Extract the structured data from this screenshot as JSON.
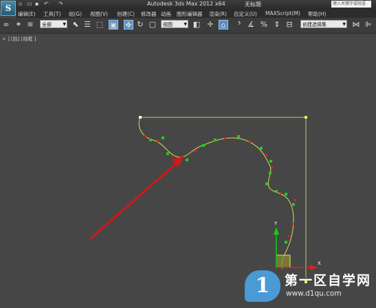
{
  "window": {
    "app_logo": "S",
    "title": "Autodesk 3ds Max  2012 x64",
    "subtitle": "无标题",
    "search_placeholder": "键入关键字或短语"
  },
  "menu": [
    "编辑(E)",
    "工具(T)",
    "组(G)",
    "视图(V)",
    "创建(C)",
    "修改器",
    "动画",
    "图形编辑器",
    "渲染(R)",
    "自定义(U)",
    "MAXScript(M)",
    "帮助(H)"
  ],
  "toolbar": {
    "selection_filter": "全部",
    "coordinate_system": "视图",
    "selection_set": "创建选择集"
  },
  "viewport": {
    "label": "+ ] [前] [线框 ]",
    "axis_y": "Y",
    "axis_x": "X"
  },
  "watermark": {
    "logo": "1",
    "text": "第一区自学网",
    "url": "www.d1qu.com"
  },
  "colors": {
    "spline": "#dcdc50",
    "vertex": "#22cc22",
    "handle": "#e02020",
    "arrow": "#d01818",
    "gizmo_y": "#18c818",
    "gizmo_x": "#e02020"
  }
}
